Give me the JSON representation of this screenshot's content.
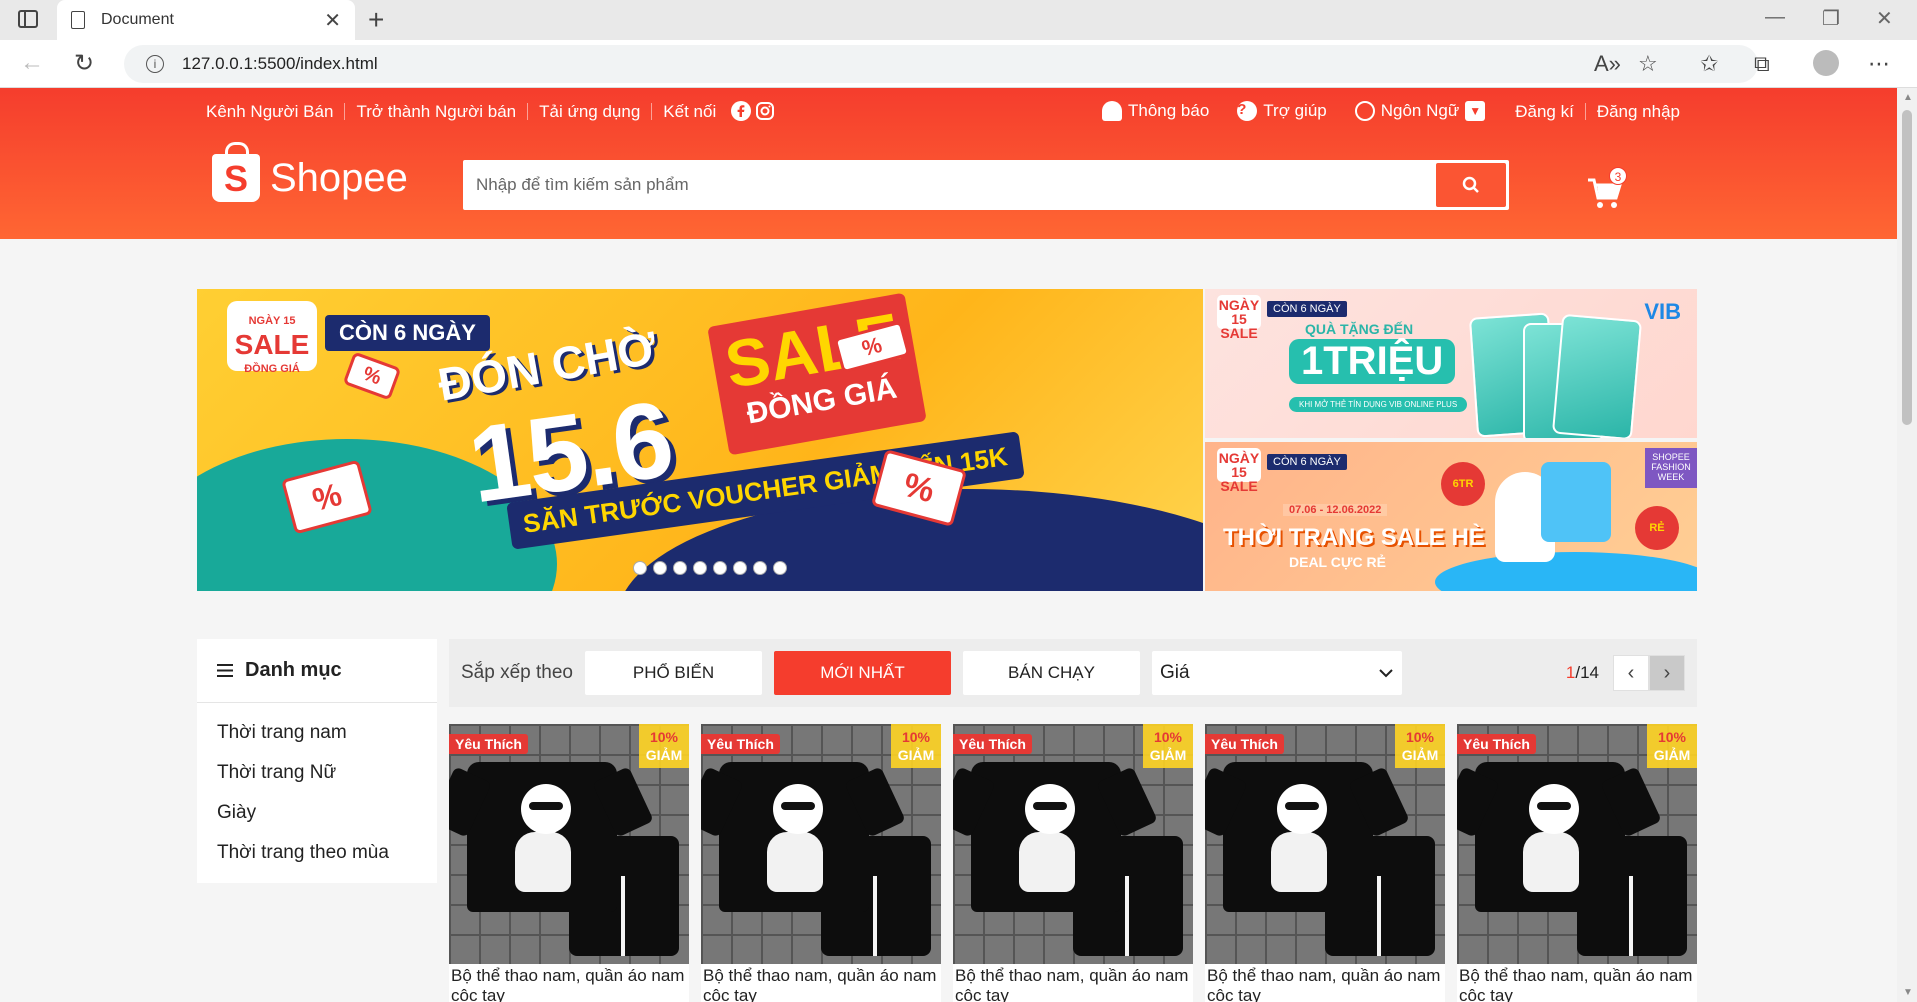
{
  "browser": {
    "tab_title": "Document",
    "url": "127.0.0.1:5500/index.html"
  },
  "header": {
    "topnav_left": [
      "Kênh Người Bán",
      "Trở thành Người bán",
      "Tải ứng dụng",
      "Kết nối"
    ],
    "notify": "Thông báo",
    "help": "Trợ giúp",
    "language": "Ngôn Ngữ",
    "register": "Đăng kí",
    "login": "Đăng nhập",
    "logo_text": "Shopee",
    "logo_letter": "S",
    "search_placeholder": "Nhập để tìm kiếm sản phẩm",
    "cart_count": "3"
  },
  "banner_main": {
    "tag_day": "NGÀY 15",
    "tag_sale": "SALE",
    "tag_same": "ĐỒNG GIÁ",
    "days_left": "CÒN 6 NGÀY",
    "title": "ĐÓN CHỜ",
    "big": "15.6",
    "sale": "SALE",
    "sale_sub": "ĐỒNG GIÁ",
    "voucher": "SĂN TRƯỚC VOUCHER GIẢM ĐẾN 15K",
    "percent": "%",
    "dots": 8
  },
  "banner_side1": {
    "tag": "NGÀY 15 SALE",
    "days_left": "CÒN 6 NGÀY",
    "brand": "VIB",
    "caption": "QUÀ TẶNG ĐẾN",
    "amount": "1TRIỆU",
    "sub": "KHI MỞ THẺ TÍN DỤNG VIB ONLINE PLUS"
  },
  "banner_side2": {
    "tag": "NGÀY 15 SALE",
    "days_left": "CÒN 6 NGÀY",
    "date": "07.06 - 12.06.2022",
    "title": "THỜI TRANG SALE HÈ",
    "sub": "DEAL CỰC RẺ",
    "fashion": "SHOPEE FASHION WEEK",
    "badge1": "6TR",
    "badge2": "RẺ"
  },
  "category": {
    "title": "Danh mục",
    "items": [
      "Thời trang nam",
      "Thời trang Nữ",
      "Giày",
      "Thời trang theo mùa"
    ]
  },
  "sort": {
    "label": "Sắp xếp theo",
    "popular": "PHỔ BIẾN",
    "newest": "MỚI NHẤT",
    "bestseller": "BÁN CHẠY",
    "price": "Giá",
    "page_current": "1",
    "page_total": "/14"
  },
  "products": [
    {
      "fav": "Yêu Thích",
      "discount": "10%",
      "discount_label": "GIẢM",
      "name": "Bộ thể thao nam, quần áo nam cộc tay"
    },
    {
      "fav": "Yêu Thích",
      "discount": "10%",
      "discount_label": "GIẢM",
      "name": "Bộ thể thao nam, quần áo nam cộc tay"
    },
    {
      "fav": "Yêu Thích",
      "discount": "10%",
      "discount_label": "GIẢM",
      "name": "Bộ thể thao nam, quần áo nam cộc tay"
    },
    {
      "fav": "Yêu Thích",
      "discount": "10%",
      "discount_label": "GIẢM",
      "name": "Bộ thể thao nam, quần áo nam cộc tay"
    },
    {
      "fav": "Yêu Thích",
      "discount": "10%",
      "discount_label": "GIẢM",
      "name": "Bộ thể thao nam, quần áo nam cộc tay"
    }
  ],
  "colors": {
    "brand": "#f53d2d",
    "discount": "#ffd424"
  }
}
